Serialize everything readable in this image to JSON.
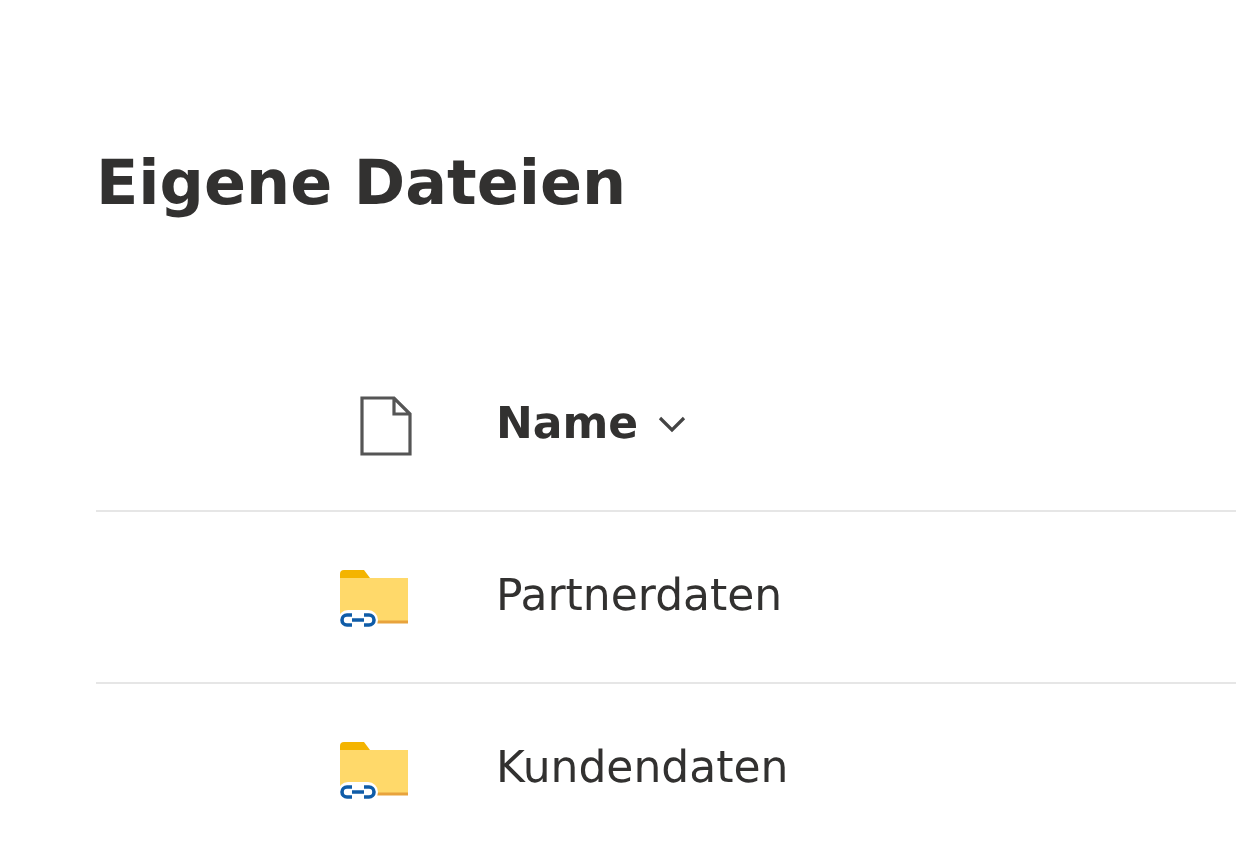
{
  "page": {
    "title": "Eigene Dateien"
  },
  "table": {
    "columns": [
      {
        "kind": "type"
      },
      {
        "kind": "name",
        "label": "Name",
        "sorted": true
      }
    ],
    "rows": [
      {
        "kind": "shared-folder",
        "name": "Partnerdaten"
      },
      {
        "kind": "shared-folder",
        "name": "Kundendaten"
      }
    ]
  }
}
